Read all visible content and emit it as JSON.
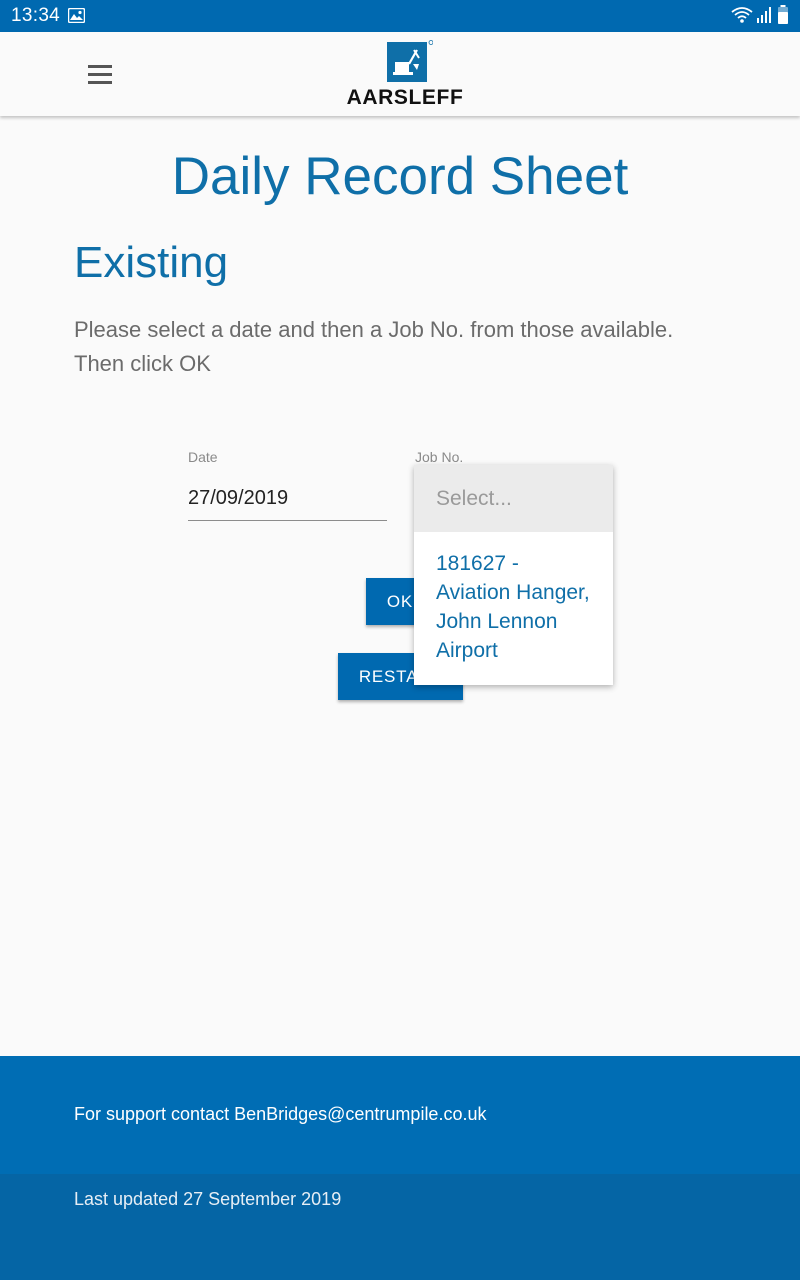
{
  "status_bar": {
    "time": "13:34",
    "icons": [
      "image-icon",
      "wifi-icon",
      "signal-icon",
      "battery-icon"
    ]
  },
  "app_bar": {
    "logo_text": "AARSLEFF",
    "menu_icon": "hamburger-menu-icon"
  },
  "main": {
    "title": "Daily Record Sheet",
    "section_title": "Existing",
    "instructions_line1": "Please select a date and then a Job No. from those available.",
    "instructions_line2": "Then click OK",
    "date_label": "Date",
    "date_value": "27/09/2019",
    "job_label": "Job No.",
    "ok_button": "OK",
    "restart_button": "RESTART"
  },
  "dropdown": {
    "placeholder": "Select...",
    "options": [
      {
        "label": "181627 - Aviation Hanger, John Lennon Airport"
      }
    ]
  },
  "footer": {
    "support": "For support contact BenBridges@centrumpile.co.uk",
    "last_updated": "Last updated 27 September 2019"
  },
  "colors": {
    "primary": "#0069b0",
    "title_blue": "#0f6fa8",
    "footer_dark": "#0565a5"
  }
}
